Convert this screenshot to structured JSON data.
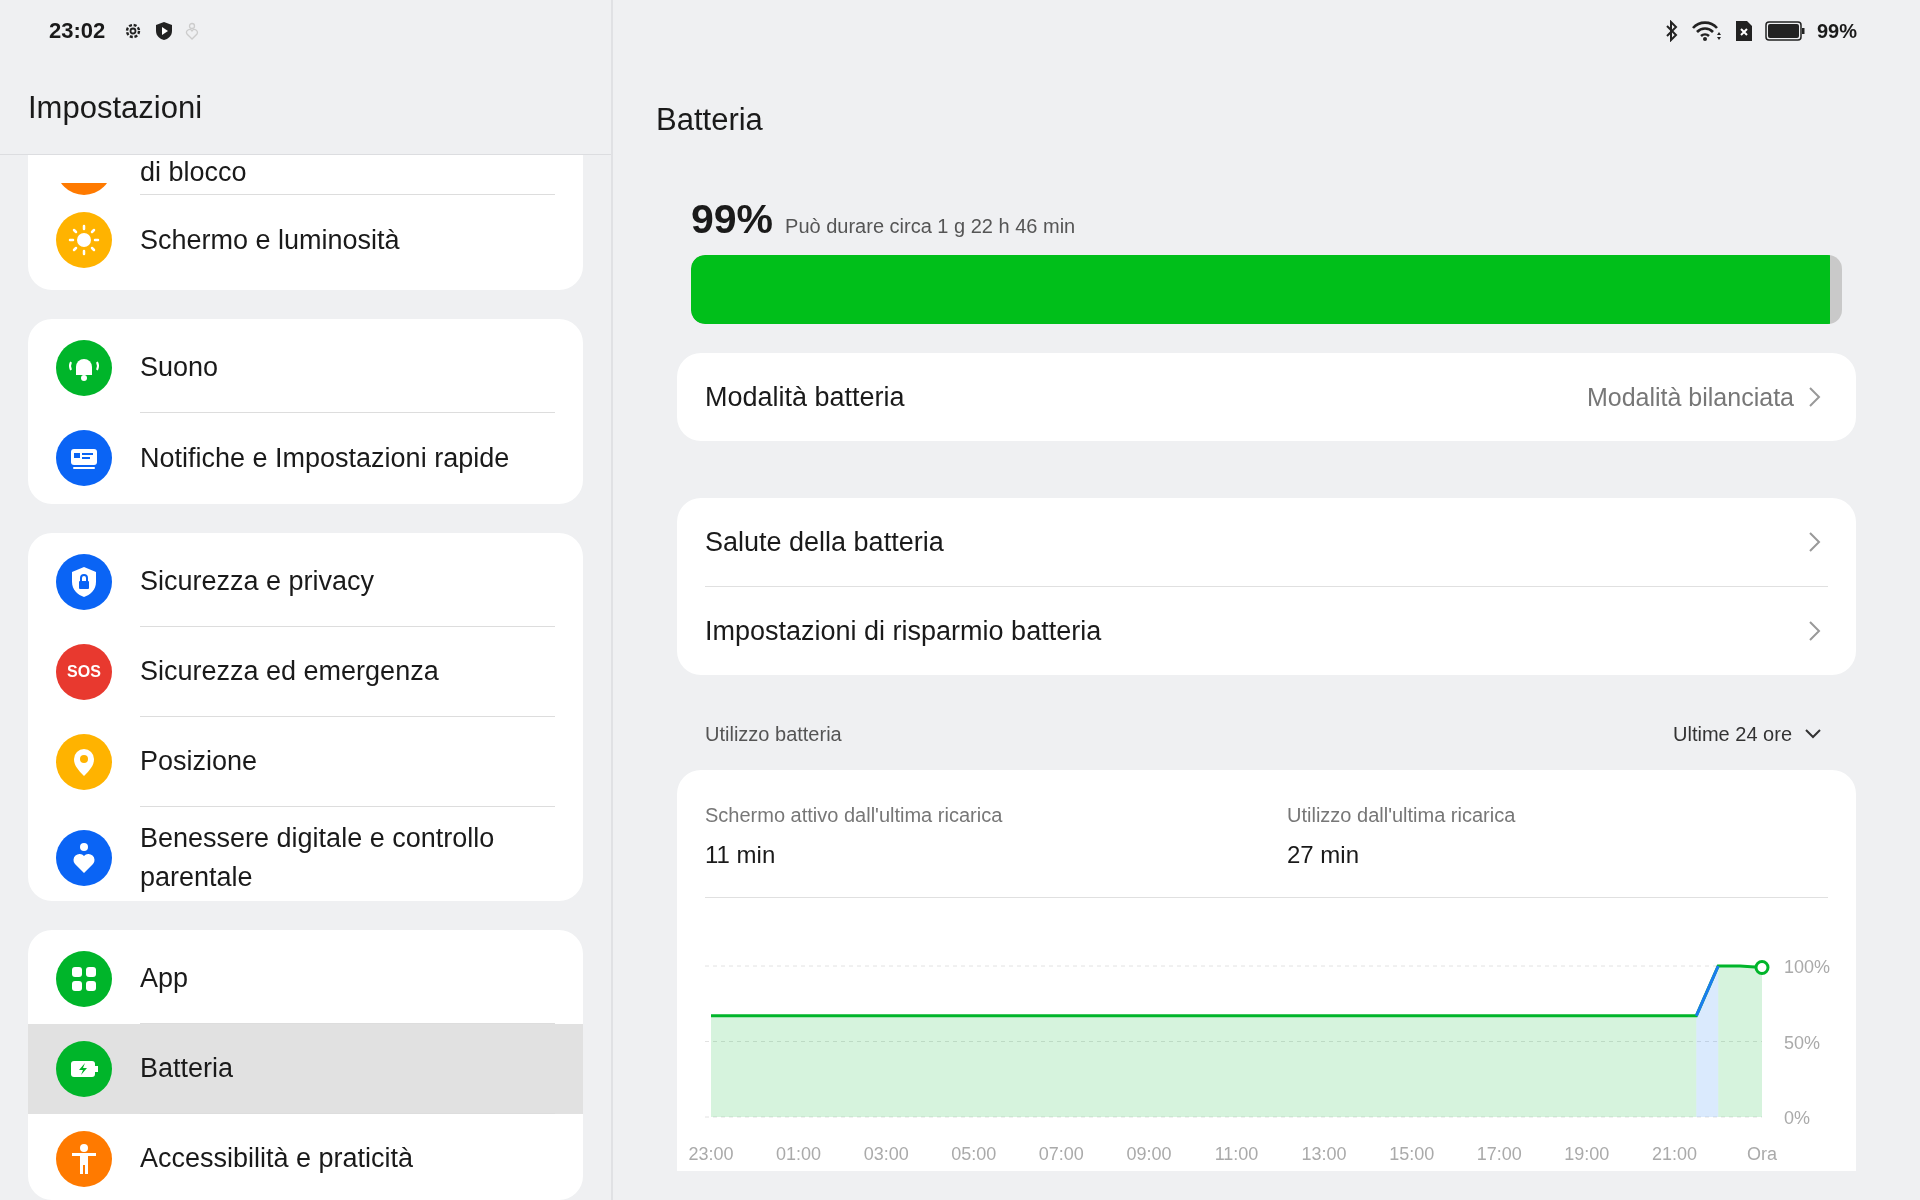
{
  "status_bar": {
    "time": "23:02",
    "battery_text": "99%"
  },
  "sidebar": {
    "title": "Impostazioni",
    "groups": [
      {
        "items": [
          {
            "label": "di blocco",
            "color": "#ff7a00",
            "selected": false,
            "partial": true
          },
          {
            "label": "Schermo e luminosità",
            "color": "#ffb300",
            "selected": false
          }
        ]
      },
      {
        "items": [
          {
            "label": "Suono",
            "color": "#00b52a",
            "selected": false
          },
          {
            "label": "Notifiche e Impostazioni rapide",
            "color": "#0a64f5",
            "selected": false
          }
        ]
      },
      {
        "items": [
          {
            "label": "Sicurezza e privacy",
            "color": "#0a64f5",
            "selected": false
          },
          {
            "label": "Sicurezza ed emergenza",
            "color": "#e8392f",
            "selected": false,
            "icon_text": "SOS"
          },
          {
            "label": "Posizione",
            "color": "#ffb300",
            "selected": false
          },
          {
            "label": "Benessere digitale e controllo parentale",
            "color": "#0a64f5",
            "selected": false
          }
        ]
      },
      {
        "items": [
          {
            "label": "App",
            "color": "#00b52a",
            "selected": false
          },
          {
            "label": "Batteria",
            "color": "#00b52a",
            "selected": true
          },
          {
            "label": "Accessibilità e praticità",
            "color": "#ff7a00",
            "selected": false
          }
        ]
      }
    ]
  },
  "page": {
    "title": "Batteria",
    "percent": "99%",
    "estimate": "Può durare circa 1 g 22 h 46 min",
    "level": 0.99,
    "mode_row": {
      "label": "Modalità batteria",
      "value": "Modalità bilanciata"
    },
    "rows": [
      {
        "label": "Salute della batteria"
      },
      {
        "label": "Impostazioni di risparmio batteria"
      }
    ],
    "usage": {
      "title": "Utilizzo batteria",
      "range": "Ultime 24 ore",
      "stats": [
        {
          "label": "Schermo attivo dall'ultima ricarica",
          "value": "11 min"
        },
        {
          "label": "Utilizzo dall'ultima ricarica",
          "value": "27 min"
        }
      ],
      "chart_data": {
        "type": "area",
        "ylim": [
          0,
          100
        ],
        "categories": [
          "23:00",
          null,
          null,
          null,
          "01:00",
          null,
          null,
          null,
          "03:00",
          null,
          null,
          null,
          "05:00",
          null,
          null,
          null,
          "07:00",
          null,
          null,
          null,
          "09:00",
          null,
          null,
          null,
          "11:00",
          null,
          null,
          null,
          "13:00",
          null,
          null,
          null,
          "15:00",
          null,
          null,
          null,
          "17:00",
          null,
          null,
          null,
          "19:00",
          null,
          null,
          null,
          "21:00",
          null,
          null,
          null,
          "Ora"
        ],
        "series": [
          {
            "color": "#00b52a",
            "values": [
              67,
              67,
              67,
              67,
              67,
              67,
              67,
              67,
              67,
              67,
              67,
              67,
              67,
              67,
              67,
              67,
              67,
              67,
              67,
              67,
              67,
              67,
              67,
              67,
              67,
              67,
              67,
              67,
              67,
              67,
              67,
              67,
              67,
              67,
              67,
              67,
              67,
              67,
              67,
              67,
              67,
              67,
              67,
              67,
              67,
              67,
              100,
              100,
              99
            ]
          },
          {
            "color": "#1a7cf0",
            "values": [
              null,
              null,
              null,
              null,
              null,
              null,
              null,
              null,
              null,
              null,
              null,
              null,
              null,
              null,
              null,
              null,
              null,
              null,
              null,
              null,
              null,
              null,
              null,
              null,
              null,
              null,
              null,
              null,
              null,
              null,
              null,
              null,
              null,
              null,
              null,
              null,
              null,
              null,
              null,
              null,
              null,
              null,
              null,
              null,
              null,
              67,
              100,
              null,
              null
            ]
          }
        ],
        "yticks": [
          {
            "value": 0,
            "label": "0%"
          },
          {
            "value": 50,
            "label": "50%"
          },
          {
            "value": 100,
            "label": "100%"
          }
        ]
      }
    }
  }
}
